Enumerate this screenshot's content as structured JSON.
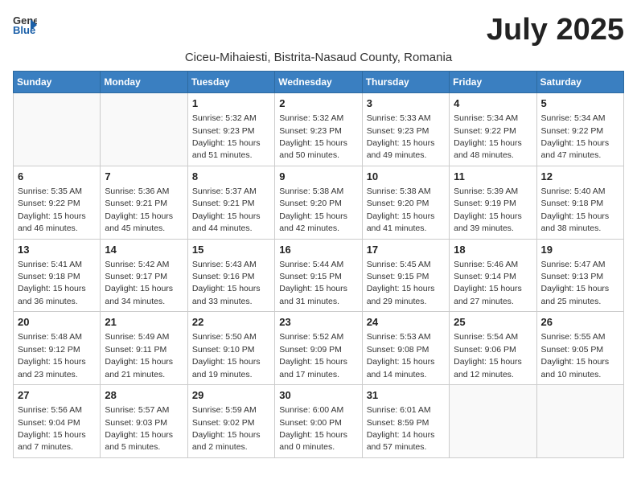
{
  "header": {
    "logo_general": "General",
    "logo_blue": "Blue",
    "month_year": "July 2025",
    "location": "Ciceu-Mihaiesti, Bistrita-Nasaud County, Romania"
  },
  "weekdays": [
    "Sunday",
    "Monday",
    "Tuesday",
    "Wednesday",
    "Thursday",
    "Friday",
    "Saturday"
  ],
  "weeks": [
    [
      {
        "day": null
      },
      {
        "day": null
      },
      {
        "day": "1",
        "sunrise": "5:32 AM",
        "sunset": "9:23 PM",
        "daylight": "15 hours and 51 minutes."
      },
      {
        "day": "2",
        "sunrise": "5:32 AM",
        "sunset": "9:23 PM",
        "daylight": "15 hours and 50 minutes."
      },
      {
        "day": "3",
        "sunrise": "5:33 AM",
        "sunset": "9:23 PM",
        "daylight": "15 hours and 49 minutes."
      },
      {
        "day": "4",
        "sunrise": "5:34 AM",
        "sunset": "9:22 PM",
        "daylight": "15 hours and 48 minutes."
      },
      {
        "day": "5",
        "sunrise": "5:34 AM",
        "sunset": "9:22 PM",
        "daylight": "15 hours and 47 minutes."
      }
    ],
    [
      {
        "day": "6",
        "sunrise": "5:35 AM",
        "sunset": "9:22 PM",
        "daylight": "15 hours and 46 minutes."
      },
      {
        "day": "7",
        "sunrise": "5:36 AM",
        "sunset": "9:21 PM",
        "daylight": "15 hours and 45 minutes."
      },
      {
        "day": "8",
        "sunrise": "5:37 AM",
        "sunset": "9:21 PM",
        "daylight": "15 hours and 44 minutes."
      },
      {
        "day": "9",
        "sunrise": "5:38 AM",
        "sunset": "9:20 PM",
        "daylight": "15 hours and 42 minutes."
      },
      {
        "day": "10",
        "sunrise": "5:38 AM",
        "sunset": "9:20 PM",
        "daylight": "15 hours and 41 minutes."
      },
      {
        "day": "11",
        "sunrise": "5:39 AM",
        "sunset": "9:19 PM",
        "daylight": "15 hours and 39 minutes."
      },
      {
        "day": "12",
        "sunrise": "5:40 AM",
        "sunset": "9:18 PM",
        "daylight": "15 hours and 38 minutes."
      }
    ],
    [
      {
        "day": "13",
        "sunrise": "5:41 AM",
        "sunset": "9:18 PM",
        "daylight": "15 hours and 36 minutes."
      },
      {
        "day": "14",
        "sunrise": "5:42 AM",
        "sunset": "9:17 PM",
        "daylight": "15 hours and 34 minutes."
      },
      {
        "day": "15",
        "sunrise": "5:43 AM",
        "sunset": "9:16 PM",
        "daylight": "15 hours and 33 minutes."
      },
      {
        "day": "16",
        "sunrise": "5:44 AM",
        "sunset": "9:15 PM",
        "daylight": "15 hours and 31 minutes."
      },
      {
        "day": "17",
        "sunrise": "5:45 AM",
        "sunset": "9:15 PM",
        "daylight": "15 hours and 29 minutes."
      },
      {
        "day": "18",
        "sunrise": "5:46 AM",
        "sunset": "9:14 PM",
        "daylight": "15 hours and 27 minutes."
      },
      {
        "day": "19",
        "sunrise": "5:47 AM",
        "sunset": "9:13 PM",
        "daylight": "15 hours and 25 minutes."
      }
    ],
    [
      {
        "day": "20",
        "sunrise": "5:48 AM",
        "sunset": "9:12 PM",
        "daylight": "15 hours and 23 minutes."
      },
      {
        "day": "21",
        "sunrise": "5:49 AM",
        "sunset": "9:11 PM",
        "daylight": "15 hours and 21 minutes."
      },
      {
        "day": "22",
        "sunrise": "5:50 AM",
        "sunset": "9:10 PM",
        "daylight": "15 hours and 19 minutes."
      },
      {
        "day": "23",
        "sunrise": "5:52 AM",
        "sunset": "9:09 PM",
        "daylight": "15 hours and 17 minutes."
      },
      {
        "day": "24",
        "sunrise": "5:53 AM",
        "sunset": "9:08 PM",
        "daylight": "15 hours and 14 minutes."
      },
      {
        "day": "25",
        "sunrise": "5:54 AM",
        "sunset": "9:06 PM",
        "daylight": "15 hours and 12 minutes."
      },
      {
        "day": "26",
        "sunrise": "5:55 AM",
        "sunset": "9:05 PM",
        "daylight": "15 hours and 10 minutes."
      }
    ],
    [
      {
        "day": "27",
        "sunrise": "5:56 AM",
        "sunset": "9:04 PM",
        "daylight": "15 hours and 7 minutes."
      },
      {
        "day": "28",
        "sunrise": "5:57 AM",
        "sunset": "9:03 PM",
        "daylight": "15 hours and 5 minutes."
      },
      {
        "day": "29",
        "sunrise": "5:59 AM",
        "sunset": "9:02 PM",
        "daylight": "15 hours and 2 minutes."
      },
      {
        "day": "30",
        "sunrise": "6:00 AM",
        "sunset": "9:00 PM",
        "daylight": "15 hours and 0 minutes."
      },
      {
        "day": "31",
        "sunrise": "6:01 AM",
        "sunset": "8:59 PM",
        "daylight": "14 hours and 57 minutes."
      },
      {
        "day": null
      },
      {
        "day": null
      }
    ]
  ]
}
